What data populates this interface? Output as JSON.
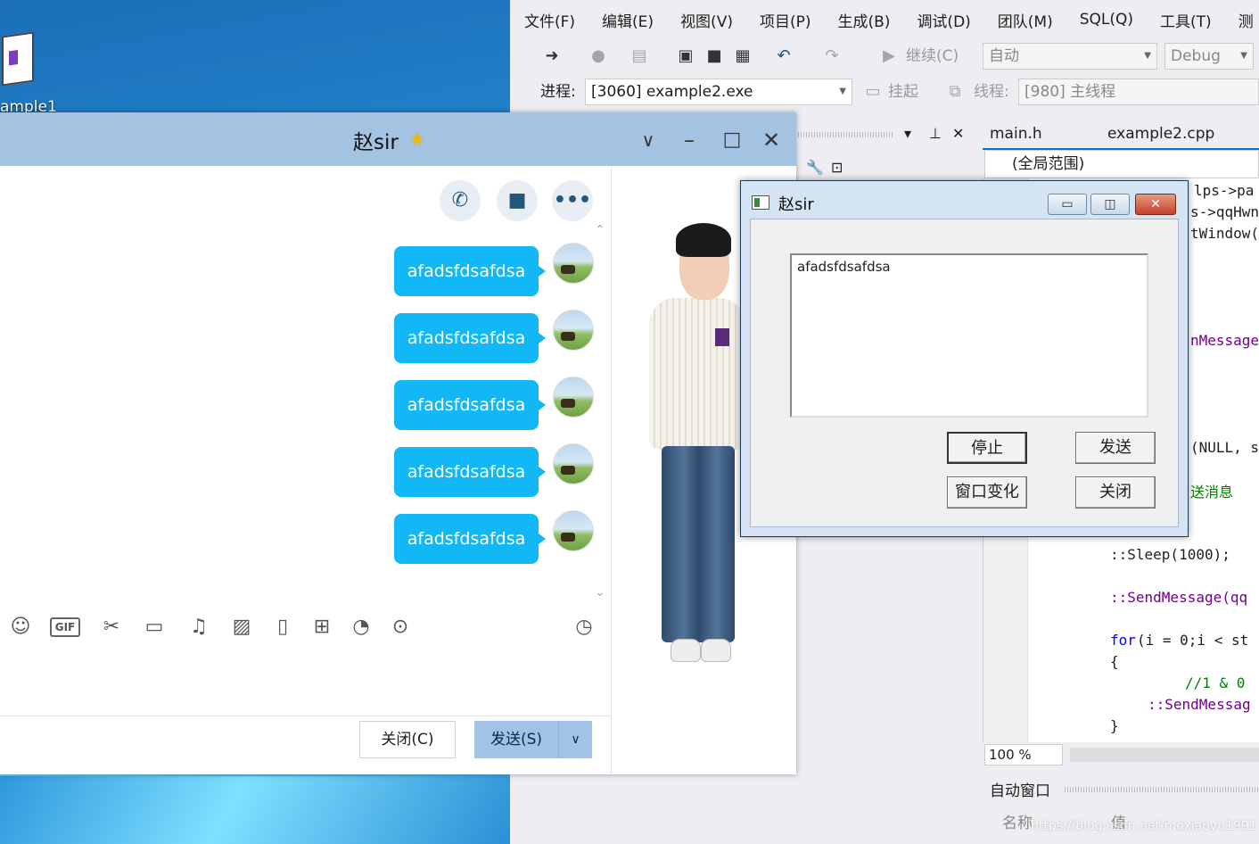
{
  "desktop": {
    "icon_label": "ample1"
  },
  "vs": {
    "menu": [
      "文件(F)",
      "编辑(E)",
      "视图(V)",
      "项目(P)",
      "生成(B)",
      "调试(D)",
      "团队(M)",
      "SQL(Q)",
      "工具(T)",
      "测"
    ],
    "toolbar": {
      "continue_label": "继续(C)",
      "solution_config": "自动",
      "build_config": "Debug"
    },
    "toolbar2": {
      "process_label": "进程:",
      "process_value": "[3060] example2.exe",
      "suspend_label": "挂起",
      "thread_label": "线程:",
      "thread_value": "[980] 主线程"
    },
    "tabs": [
      "main.h",
      "example2.cpp"
    ],
    "scope": "(全局范围)",
    "code": {
      "frag1": "lps->pa",
      "frag2": "s->qqHwn",
      "frag3": "tWindow(",
      "frag4": "nMessage",
      "frag5": "(NULL, sz",
      "frag6": "送消息",
      "sleep": "::Sleep(1000);",
      "send": "::SendMessage(qq",
      "for_kw": "for",
      "for_rest": "(i = 0;i < st",
      "brace_open": "{",
      "comment": "//1 & 0",
      "send2": "::SendMessag",
      "brace_close": "}"
    },
    "zoom": "100 %",
    "auto_window_label": "自动窗口",
    "col_name": "名称",
    "col_value": "值",
    "watermark": "https://blog.csdn.net/moxiaoyu1991"
  },
  "qq": {
    "title": "赵sir",
    "messages": [
      "afadsfdsafdsa",
      "afadsfdsafdsa",
      "afadsfdsafdsa",
      "afadsfdsafdsa",
      "afadsfdsafdsa"
    ],
    "tools": {
      "gif": "GIF"
    },
    "close_button": "关闭(C)",
    "send_button": "发送(S)"
  },
  "dialog": {
    "title": "赵sir",
    "edit_text": "afadsfdsafdsa",
    "stop": "停止",
    "send": "发送",
    "resize": "窗口变化",
    "close": "关闭"
  },
  "colors": {
    "bubble": "#12b7f5",
    "qq_titlebar": "#a4c3e2",
    "vs_accent": "#007acc"
  }
}
